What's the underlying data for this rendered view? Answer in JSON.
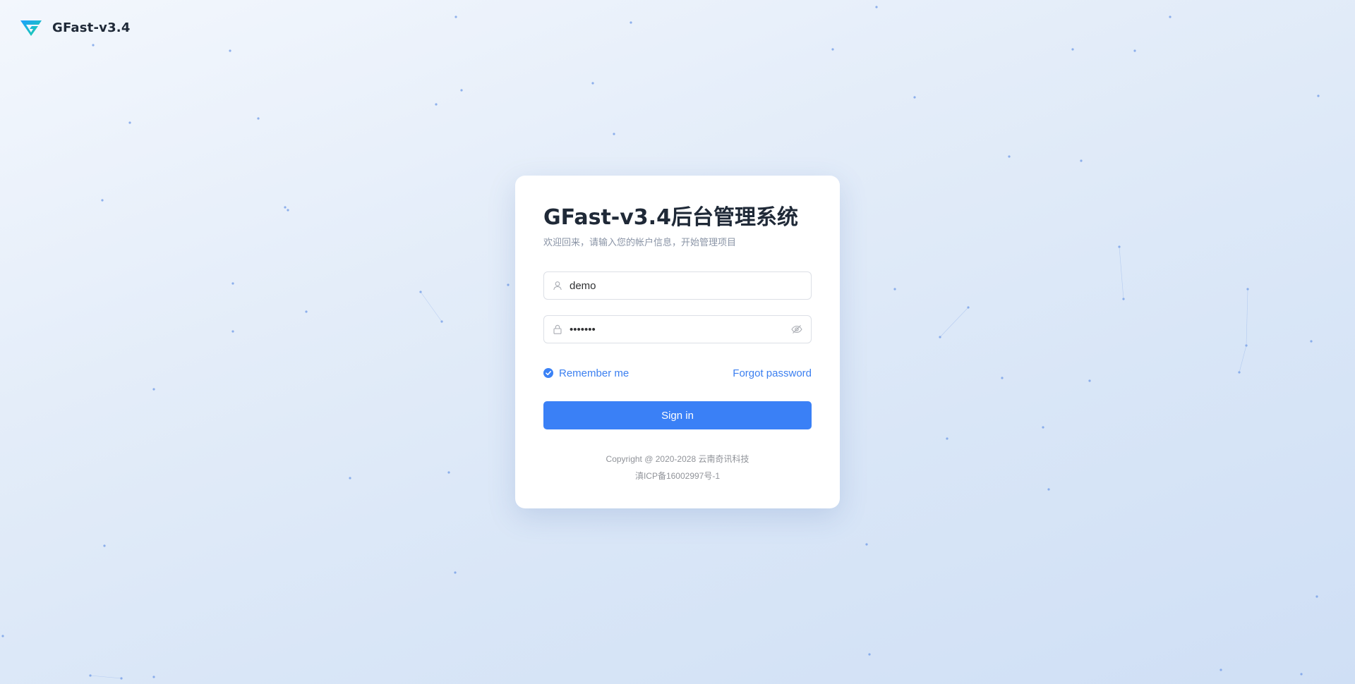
{
  "brand": {
    "name": "GFast-v3.4",
    "logo_icon": "gfast-logo-icon",
    "logo_colors": [
      "#1e9fff",
      "#19d3a2"
    ]
  },
  "login": {
    "title": "GFast-v3.4后台管理系统",
    "subtitle": "欢迎回来，请输入您的帐户信息，开始管理项目",
    "username": {
      "value": "demo",
      "icon": "user-icon"
    },
    "password": {
      "value": "demo123",
      "icon": "lock-icon",
      "toggle_icon": "eye-off-icon"
    },
    "remember_me": {
      "label": "Remember me",
      "checked": true
    },
    "forgot_password_label": "Forgot password",
    "sign_in_label": "Sign in",
    "footer": {
      "copyright": "Copyright @ 2020-2028 云南奇讯科技",
      "icp": "滇ICP备16002997号-1"
    }
  },
  "colors": {
    "accent": "#3a80f6",
    "link": "#3b7ff0",
    "background_from": "#f3f7fd",
    "background_to": "#cfdff5"
  }
}
